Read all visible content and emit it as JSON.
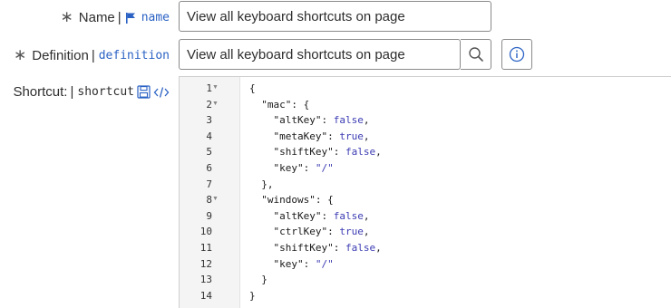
{
  "form": {
    "name": {
      "required_mark": "∗",
      "label": "Name",
      "separator": "|",
      "field_name": "name",
      "value": "View all keyboard shortcuts on page"
    },
    "definition": {
      "required_mark": "∗",
      "label": "Definition",
      "separator": "|",
      "field_name": "definition",
      "value": "View all keyboard shortcuts on page"
    },
    "shortcut": {
      "label": "Shortcut:",
      "separator": "|",
      "field_name": "shortcut"
    }
  },
  "icons": {
    "flag": "flag-icon",
    "search": "search-icon",
    "info": "info-icon",
    "save": "save-icon",
    "code": "code-icon"
  },
  "colors": {
    "accent": "#2b62c4",
    "json_value": "#3b3bb3"
  },
  "editor": {
    "lines": [
      {
        "num": "1",
        "fold": true,
        "parts": [
          {
            "t": "{",
            "c": ""
          }
        ]
      },
      {
        "num": "2",
        "fold": true,
        "parts": [
          {
            "t": "  \"mac\": {",
            "c": "tok-key"
          }
        ]
      },
      {
        "num": "3",
        "fold": false,
        "parts": [
          {
            "t": "    \"altKey\": ",
            "c": "tok-key"
          },
          {
            "t": "false",
            "c": "tok-val"
          },
          {
            "t": ",",
            "c": ""
          }
        ]
      },
      {
        "num": "4",
        "fold": false,
        "parts": [
          {
            "t": "    \"metaKey\": ",
            "c": "tok-key"
          },
          {
            "t": "true",
            "c": "tok-val"
          },
          {
            "t": ",",
            "c": ""
          }
        ]
      },
      {
        "num": "5",
        "fold": false,
        "parts": [
          {
            "t": "    \"shiftKey\": ",
            "c": "tok-key"
          },
          {
            "t": "false",
            "c": "tok-val"
          },
          {
            "t": ",",
            "c": ""
          }
        ]
      },
      {
        "num": "6",
        "fold": false,
        "parts": [
          {
            "t": "    \"key\": ",
            "c": "tok-key"
          },
          {
            "t": "\"/\"",
            "c": "tok-str"
          }
        ]
      },
      {
        "num": "7",
        "fold": false,
        "parts": [
          {
            "t": "  },",
            "c": ""
          }
        ]
      },
      {
        "num": "8",
        "fold": true,
        "parts": [
          {
            "t": "  \"windows\": {",
            "c": "tok-key"
          }
        ]
      },
      {
        "num": "9",
        "fold": false,
        "parts": [
          {
            "t": "    \"altKey\": ",
            "c": "tok-key"
          },
          {
            "t": "false",
            "c": "tok-val"
          },
          {
            "t": ",",
            "c": ""
          }
        ]
      },
      {
        "num": "10",
        "fold": false,
        "parts": [
          {
            "t": "    \"ctrlKey\": ",
            "c": "tok-key"
          },
          {
            "t": "true",
            "c": "tok-val"
          },
          {
            "t": ",",
            "c": ""
          }
        ]
      },
      {
        "num": "11",
        "fold": false,
        "parts": [
          {
            "t": "    \"shiftKey\": ",
            "c": "tok-key"
          },
          {
            "t": "false",
            "c": "tok-val"
          },
          {
            "t": ",",
            "c": ""
          }
        ]
      },
      {
        "num": "12",
        "fold": false,
        "parts": [
          {
            "t": "    \"key\": ",
            "c": "tok-key"
          },
          {
            "t": "\"/\"",
            "c": "tok-str"
          }
        ]
      },
      {
        "num": "13",
        "fold": false,
        "parts": [
          {
            "t": "  }",
            "c": ""
          }
        ]
      },
      {
        "num": "14",
        "fold": false,
        "parts": [
          {
            "t": "}",
            "c": ""
          }
        ]
      }
    ]
  }
}
